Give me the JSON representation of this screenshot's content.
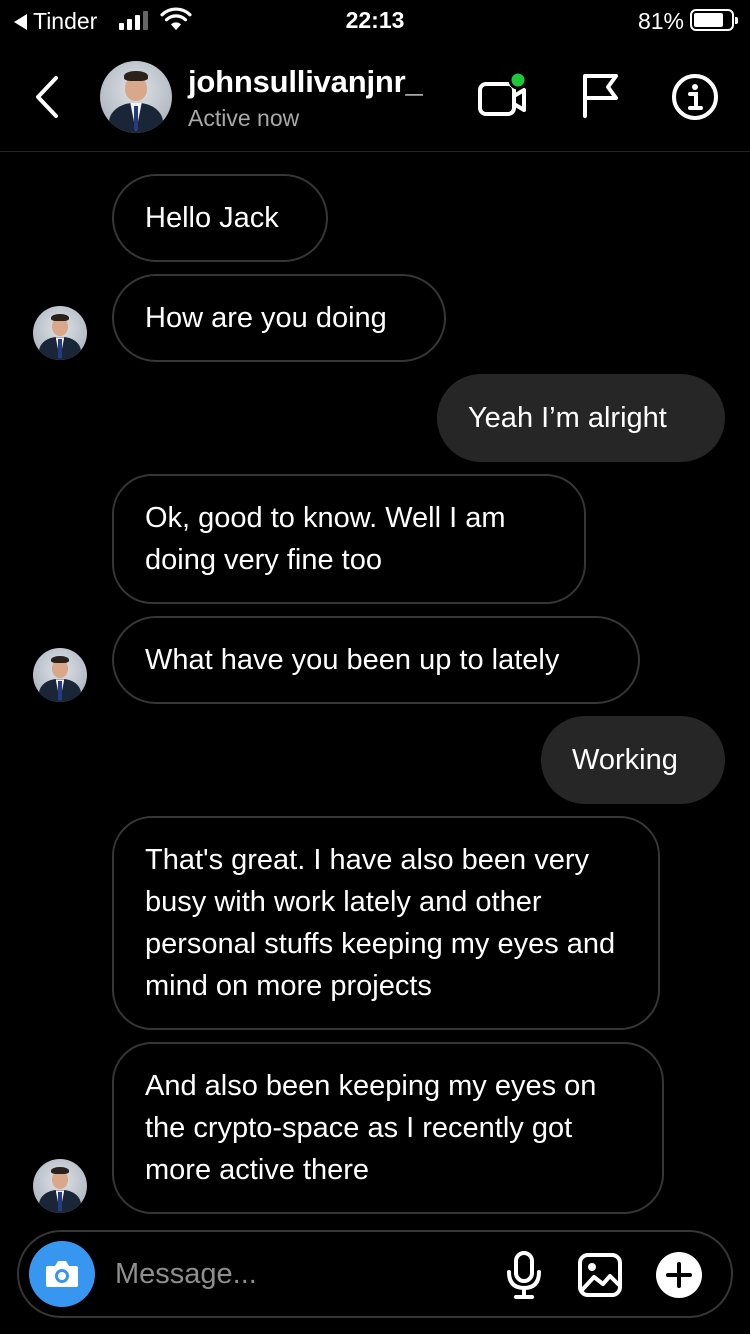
{
  "status_bar": {
    "back_app": "Tinder",
    "time": "22:13",
    "battery_pct": "81%",
    "battery_level": 0.81
  },
  "header": {
    "username": "johnsullivanjnr_",
    "status": "Active now",
    "video_active_color": "#1fc839"
  },
  "messages": [
    {
      "side": "in",
      "text": "Hello Jack"
    },
    {
      "side": "in",
      "text": "How are you doing"
    },
    {
      "side": "out",
      "text": "Yeah I’m alright"
    },
    {
      "side": "in",
      "text": "Ok, good to know. Well I am doing very fine too"
    },
    {
      "side": "in",
      "text": "What have you been up to lately"
    },
    {
      "side": "out",
      "text": "Working"
    },
    {
      "side": "in",
      "text": "That's great. I have also been very busy with work lately and other personal stuffs keeping my eyes and mind on more projects"
    },
    {
      "side": "in",
      "text": "And also been keeping my eyes on the crypto-space as I recently got more active there"
    }
  ],
  "composer": {
    "placeholder": "Message...",
    "camera_color": "#3797f0"
  },
  "icons": [
    "back-chevron-icon",
    "video-call-icon",
    "flag-icon",
    "info-icon",
    "camera-icon",
    "microphone-icon",
    "gallery-icon",
    "plus-icon"
  ]
}
